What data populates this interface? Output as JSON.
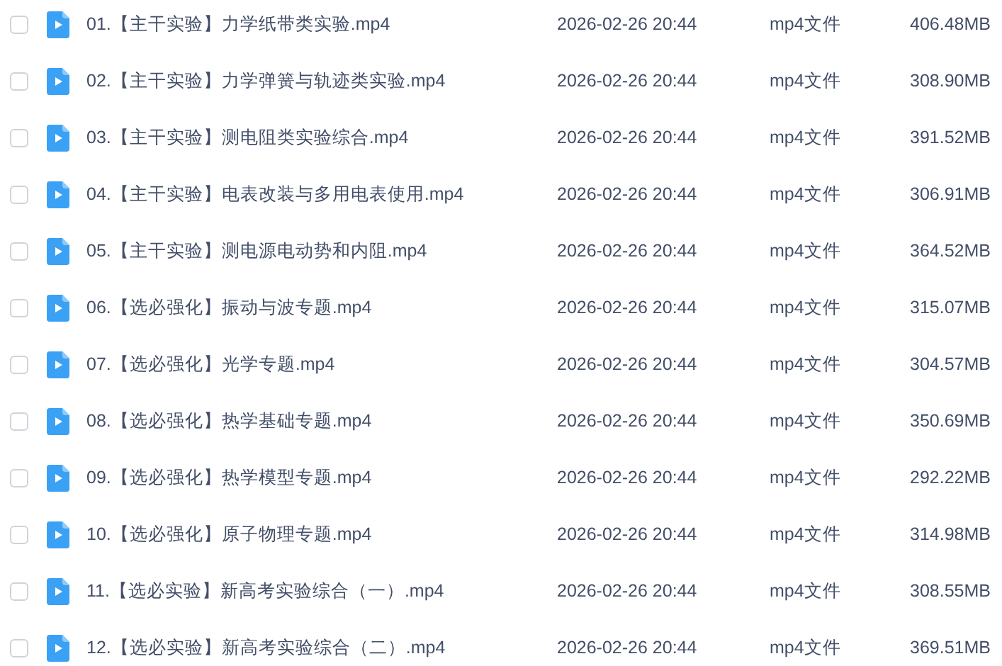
{
  "files": [
    {
      "checked": false,
      "name": "01.【主干实验】力学纸带类实验.mp4",
      "modified": "2026-02-26 20:44",
      "type": "mp4文件",
      "size": "406.48MB"
    },
    {
      "checked": false,
      "name": "02.【主干实验】力学弹簧与轨迹类实验.mp4",
      "modified": "2026-02-26 20:44",
      "type": "mp4文件",
      "size": "308.90MB"
    },
    {
      "checked": false,
      "name": "03.【主干实验】测电阻类实验综合.mp4",
      "modified": "2026-02-26 20:44",
      "type": "mp4文件",
      "size": "391.52MB"
    },
    {
      "checked": false,
      "name": "04.【主干实验】电表改装与多用电表使用.mp4",
      "modified": "2026-02-26 20:44",
      "type": "mp4文件",
      "size": "306.91MB"
    },
    {
      "checked": false,
      "name": "05.【主干实验】测电源电动势和内阻.mp4",
      "modified": "2026-02-26 20:44",
      "type": "mp4文件",
      "size": "364.52MB"
    },
    {
      "checked": false,
      "name": "06.【选必强化】振动与波专题.mp4",
      "modified": "2026-02-26 20:44",
      "type": "mp4文件",
      "size": "315.07MB"
    },
    {
      "checked": false,
      "name": "07.【选必强化】光学专题.mp4",
      "modified": "2026-02-26 20:44",
      "type": "mp4文件",
      "size": "304.57MB"
    },
    {
      "checked": false,
      "name": "08.【选必强化】热学基础专题.mp4",
      "modified": "2026-02-26 20:44",
      "type": "mp4文件",
      "size": "350.69MB"
    },
    {
      "checked": false,
      "name": "09.【选必强化】热学模型专题.mp4",
      "modified": "2026-02-26 20:44",
      "type": "mp4文件",
      "size": "292.22MB"
    },
    {
      "checked": false,
      "name": "10.【选必强化】原子物理专题.mp4",
      "modified": "2026-02-26 20:44",
      "type": "mp4文件",
      "size": "314.98MB"
    },
    {
      "checked": false,
      "name": "11.【选必实验】新高考实验综合（一）.mp4",
      "modified": "2026-02-26 20:44",
      "type": "mp4文件",
      "size": "308.55MB"
    },
    {
      "checked": false,
      "name": "12.【选必实验】新高考实验综合（二）.mp4",
      "modified": "2026-02-26 20:44",
      "type": "mp4文件",
      "size": "369.51MB"
    }
  ]
}
